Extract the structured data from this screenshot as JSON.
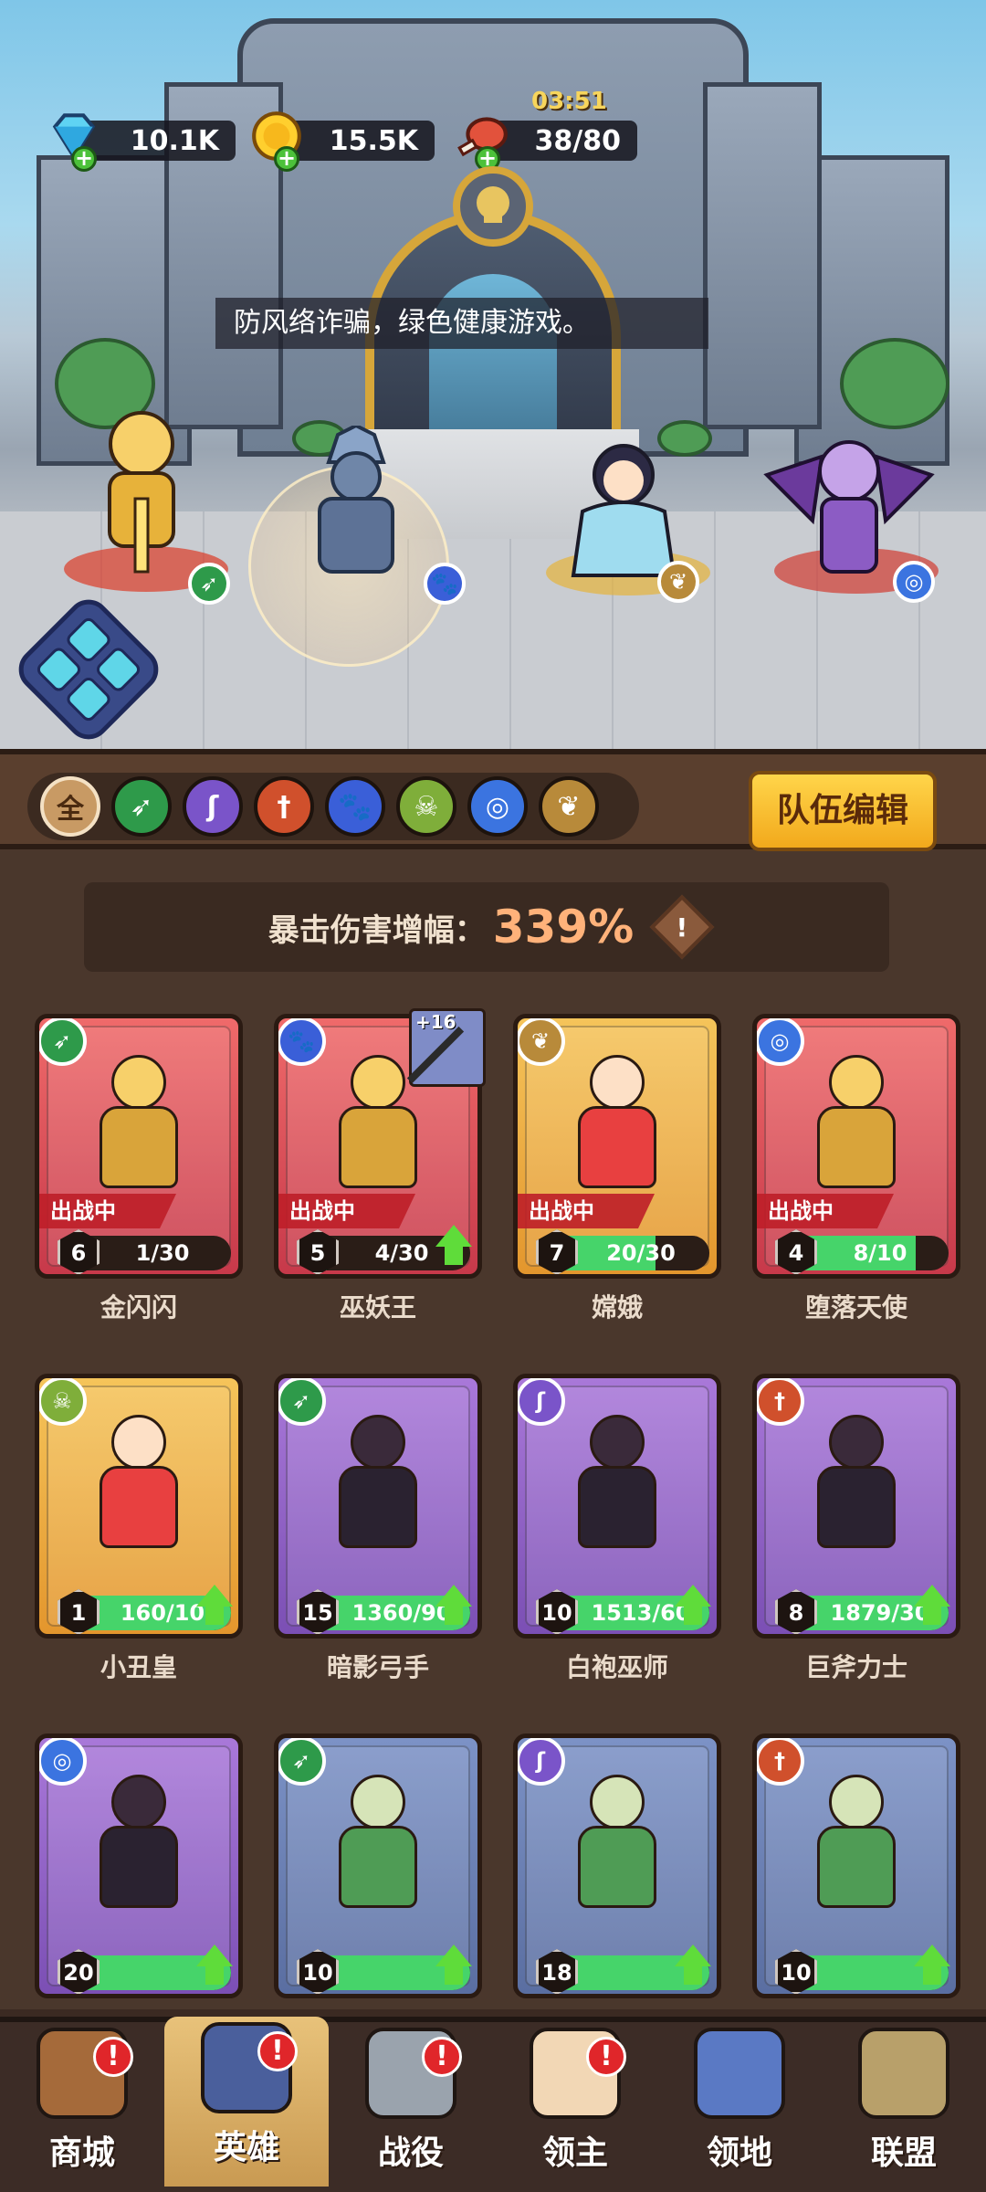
{
  "resources": {
    "gems": "10.1K",
    "gold": "15.5K",
    "stamina": "38/80",
    "timer": "03:51"
  },
  "notice": "防风络诈骗，绿色健康游戏。",
  "filters": [
    "全",
    "archer",
    "mage",
    "warrior",
    "beast",
    "skull",
    "spiral",
    "wing"
  ],
  "team_edit_label": "队伍编辑",
  "crit": {
    "label": "暴击伤害增幅：",
    "value": "339%",
    "warn": "!"
  },
  "heroes": [
    {
      "name": "金闪闪",
      "status": "出战中",
      "level": "6",
      "progress": "1/30",
      "fill": 0.03,
      "color": "red",
      "class": "archer",
      "upgrade": false
    },
    {
      "name": "巫妖王",
      "status": "出战中",
      "level": "5",
      "progress": "4/30",
      "fill": 0.13,
      "color": "red",
      "class": "beast",
      "upgrade": true,
      "equip": "+16"
    },
    {
      "name": "嫦娥",
      "status": "出战中",
      "level": "7",
      "progress": "20/30",
      "fill": 0.67,
      "color": "gold",
      "class": "wing",
      "upgrade": false
    },
    {
      "name": "堕落天使",
      "status": "出战中",
      "level": "4",
      "progress": "8/10",
      "fill": 0.8,
      "color": "red",
      "class": "spiral",
      "upgrade": false
    },
    {
      "name": "小丑皇",
      "status": "",
      "level": "1",
      "progress": "160/10",
      "fill": 1.0,
      "color": "gold",
      "class": "skull",
      "upgrade": true
    },
    {
      "name": "暗影弓手",
      "status": "",
      "level": "15",
      "progress": "1360/90",
      "fill": 1.0,
      "color": "purple",
      "class": "archer",
      "upgrade": true
    },
    {
      "name": "白袍巫师",
      "status": "",
      "level": "10",
      "progress": "1513/60",
      "fill": 1.0,
      "color": "purple",
      "class": "mage",
      "upgrade": true
    },
    {
      "name": "巨斧力士",
      "status": "",
      "level": "8",
      "progress": "1879/30",
      "fill": 1.0,
      "color": "purple",
      "class": "warrior",
      "upgrade": true
    },
    {
      "name": "",
      "status": "",
      "level": "20",
      "progress": "",
      "fill": 1.0,
      "color": "purple",
      "class": "spiral",
      "upgrade": true
    },
    {
      "name": "",
      "status": "",
      "level": "10",
      "progress": "",
      "fill": 1.0,
      "color": "blue",
      "class": "archer",
      "upgrade": true
    },
    {
      "name": "",
      "status": "",
      "level": "18",
      "progress": "",
      "fill": 1.0,
      "color": "blue",
      "class": "mage",
      "upgrade": true
    },
    {
      "name": "",
      "status": "",
      "level": "10",
      "progress": "",
      "fill": 1.0,
      "color": "blue",
      "class": "warrior",
      "upgrade": true
    }
  ],
  "nav": [
    {
      "label": "商城",
      "alert": "!",
      "active": false
    },
    {
      "label": "英雄",
      "alert": "!",
      "active": true
    },
    {
      "label": "战役",
      "alert": "!",
      "active": false
    },
    {
      "label": "领主",
      "alert": "!",
      "active": false
    },
    {
      "label": "领地",
      "alert": "",
      "active": false
    },
    {
      "label": "联盟",
      "alert": "",
      "active": false
    }
  ],
  "class_colors": {
    "archer": "#2e9a4a",
    "mage": "#7a54c9",
    "warrior": "#d0502c",
    "beast": "#3a5fd8",
    "skull": "#7fae3a",
    "spiral": "#3b74e0",
    "wing": "#b88a3a",
    "all": "#c89a64"
  }
}
